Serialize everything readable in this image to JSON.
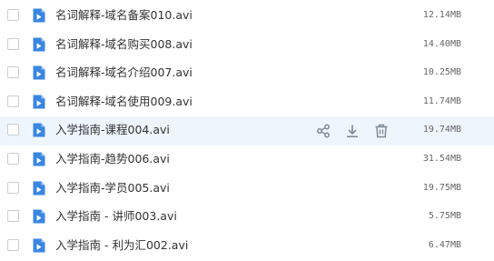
{
  "colors": {
    "hover_row_bg": "#eef5fd",
    "icon_blue": "#3a86e0",
    "action_icon": "#7f8894"
  },
  "actions": {
    "share_icon": "share-icon",
    "download_icon": "download-icon",
    "delete_icon": "trash-icon"
  },
  "files": [
    {
      "name": "名词解释-域名备案010.avi",
      "size": "12.14MB",
      "icon": "video-file-icon"
    },
    {
      "name": "名词解释-域名购买008.avi",
      "size": "14.40MB",
      "icon": "video-file-icon"
    },
    {
      "name": "名词解释-域名介绍007.avi",
      "size": "10.25MB",
      "icon": "video-file-icon"
    },
    {
      "name": "名词解释-域名使用009.avi",
      "size": "11.74MB",
      "icon": "video-file-icon"
    },
    {
      "name": "入学指南-课程004.avi",
      "size": "19.74MB",
      "icon": "video-file-icon",
      "hovered": true
    },
    {
      "name": "入学指南-趋势006.avi",
      "size": "31.54MB",
      "icon": "video-file-icon"
    },
    {
      "name": "入学指南-学员005.avi",
      "size": "19.75MB",
      "icon": "video-file-icon"
    },
    {
      "name": "入学指南 - 讲师003.avi",
      "size": "5.75MB",
      "icon": "video-file-icon"
    },
    {
      "name": "入学指南 - 利为汇002.avi",
      "size": "6.47MB",
      "icon": "video-file-icon"
    }
  ]
}
